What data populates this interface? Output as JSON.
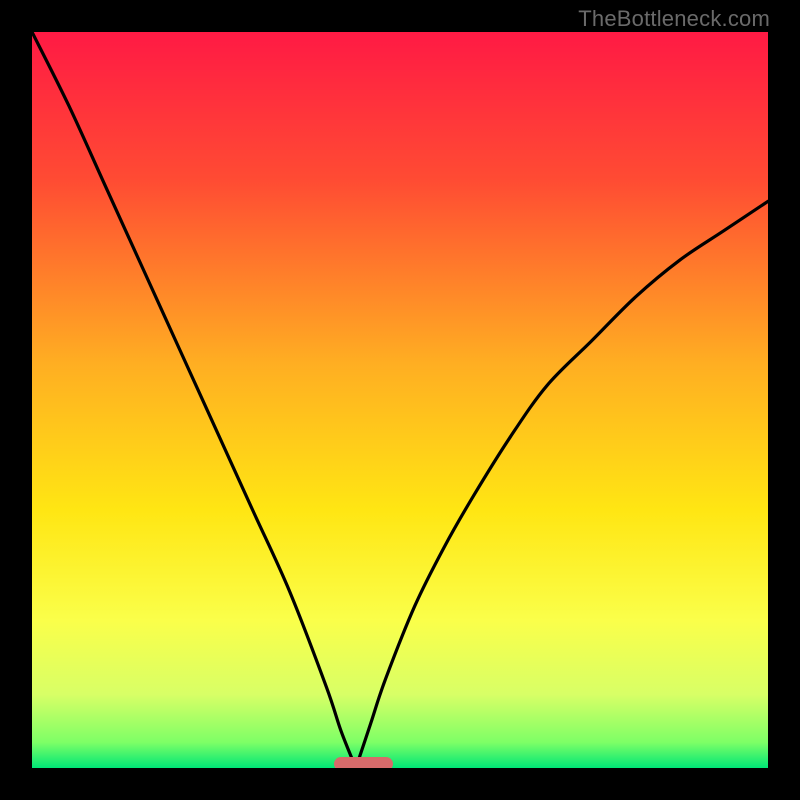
{
  "watermark": "TheBottleneck.com",
  "chart_data": {
    "type": "line",
    "title": "",
    "xlabel": "",
    "ylabel": "",
    "xlim": [
      0,
      100
    ],
    "ylim": [
      0,
      100
    ],
    "x_optimal": 44,
    "marker": {
      "x_start": 41,
      "x_end": 49,
      "color": "#d76a6a"
    },
    "gradient_stops": [
      {
        "pos": 0.0,
        "color": "#ff1a44"
      },
      {
        "pos": 0.2,
        "color": "#ff4b33"
      },
      {
        "pos": 0.45,
        "color": "#ffae22"
      },
      {
        "pos": 0.65,
        "color": "#ffe613"
      },
      {
        "pos": 0.8,
        "color": "#faff4a"
      },
      {
        "pos": 0.9,
        "color": "#d8ff66"
      },
      {
        "pos": 0.965,
        "color": "#7eff66"
      },
      {
        "pos": 1.0,
        "color": "#00e676"
      }
    ],
    "series": [
      {
        "name": "left-curve",
        "x": [
          0,
          5,
          10,
          15,
          20,
          25,
          30,
          35,
          40,
          42,
          44
        ],
        "y": [
          100,
          90,
          79,
          68,
          57,
          46,
          35,
          24,
          11,
          5,
          0
        ]
      },
      {
        "name": "right-curve",
        "x": [
          44,
          46,
          48,
          52,
          56,
          60,
          65,
          70,
          76,
          82,
          88,
          94,
          100
        ],
        "y": [
          0,
          6,
          12,
          22,
          30,
          37,
          45,
          52,
          58,
          64,
          69,
          73,
          77
        ]
      }
    ]
  }
}
